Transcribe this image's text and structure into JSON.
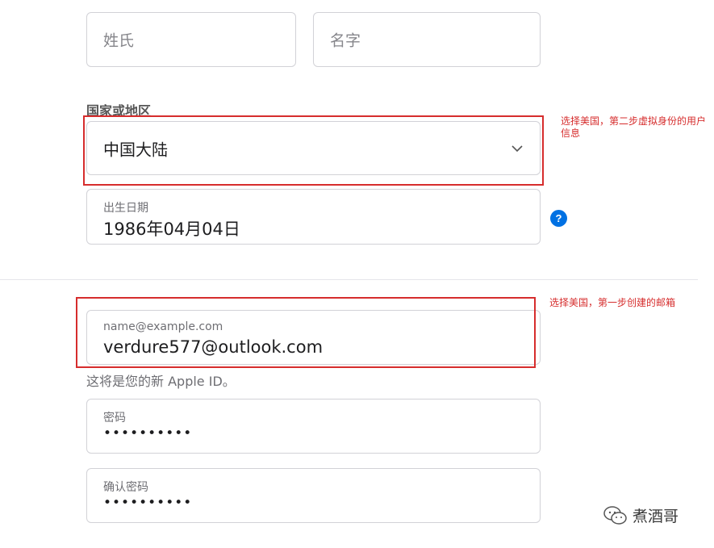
{
  "name_fields": {
    "last_name_placeholder": "姓氏",
    "first_name_placeholder": "名字"
  },
  "country": {
    "label": "国家或地区",
    "selected": "中国大陆"
  },
  "birthday": {
    "label": "出生日期",
    "value": "1986年04月04日"
  },
  "email": {
    "label": "name@example.com",
    "value": "verdure577@outlook.com",
    "hint": "这将是您的新 Apple ID。"
  },
  "password": {
    "label": "密码",
    "value": "••••••••••"
  },
  "confirm_password": {
    "label": "确认密码",
    "value": "••••••••••"
  },
  "annotations": {
    "country_note": "选择美国，第二步虚拟身份的用户信息",
    "email_note": "选择美国，第一步创建的邮箱"
  },
  "watermark": {
    "text": "煮酒哥",
    "icon": "wechat-icon"
  },
  "colors": {
    "accent": "#0071e3",
    "annotation": "#d62d2d"
  }
}
